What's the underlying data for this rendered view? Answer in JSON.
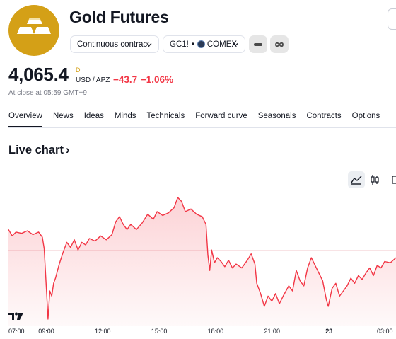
{
  "header": {
    "title": "Gold Futures",
    "contract_label": "Continuous contract",
    "symbol": "GC1!",
    "separator": "•",
    "exchange": "COMEX"
  },
  "quote": {
    "price": "4,065.4",
    "price_sup": "D",
    "currency": "USD / APZ",
    "change": "−43.7 −1.06%",
    "close_time": "At close at 05:59 GMT+9"
  },
  "tabs": [
    "Overview",
    "News",
    "Ideas",
    "Minds",
    "Technicals",
    "Forward curve",
    "Seasonals",
    "Contracts",
    "Options"
  ],
  "live_chart": {
    "label": "Live chart",
    "arrow": "›"
  },
  "icons": {
    "logo": "gold-bars-icon",
    "contract_chevron": "chevron-down-icon",
    "exchange_chevron": "chevron-down-icon",
    "compare": "minus-icon",
    "link": "infinity-link-icon",
    "area_chart": "area-chart-icon",
    "candles": "candlestick-icon",
    "brand": "tradingview-logo-icon"
  },
  "colors": {
    "accent_gold": "#d4a017",
    "negative": "#f23645",
    "line": "#f23645",
    "text": "#131722",
    "muted": "#787b86"
  },
  "chart_data": {
    "type": "area",
    "xlabels": [
      "07:00",
      "09:00",
      "12:00",
      "15:00",
      "18:00",
      "21:00",
      "23",
      "03:00"
    ],
    "x_positions_hours": [
      0,
      2,
      5,
      8,
      11,
      14,
      17,
      20
    ],
    "x_range_hours": [
      0,
      20.6
    ],
    "y_range": [
      4035,
      4140
    ],
    "grid": false,
    "points": [
      [
        0.0,
        4110
      ],
      [
        0.2,
        4105
      ],
      [
        0.4,
        4108
      ],
      [
        0.7,
        4107
      ],
      [
        1.0,
        4109
      ],
      [
        1.3,
        4106
      ],
      [
        1.6,
        4108
      ],
      [
        1.8,
        4104
      ],
      [
        1.9,
        4095
      ],
      [
        2.05,
        4055
      ],
      [
        2.1,
        4040
      ],
      [
        2.2,
        4062
      ],
      [
        2.3,
        4058
      ],
      [
        2.4,
        4068
      ],
      [
        2.5,
        4072
      ],
      [
        2.7,
        4083
      ],
      [
        2.9,
        4092
      ],
      [
        3.1,
        4100
      ],
      [
        3.3,
        4096
      ],
      [
        3.5,
        4102
      ],
      [
        3.7,
        4094
      ],
      [
        3.9,
        4100
      ],
      [
        4.1,
        4098
      ],
      [
        4.3,
        4103
      ],
      [
        4.6,
        4101
      ],
      [
        4.9,
        4105
      ],
      [
        5.2,
        4102
      ],
      [
        5.5,
        4106
      ],
      [
        5.7,
        4116
      ],
      [
        5.9,
        4120
      ],
      [
        6.1,
        4114
      ],
      [
        6.3,
        4110
      ],
      [
        6.5,
        4114
      ],
      [
        6.8,
        4110
      ],
      [
        7.1,
        4115
      ],
      [
        7.4,
        4122
      ],
      [
        7.7,
        4118
      ],
      [
        7.9,
        4124
      ],
      [
        8.2,
        4121
      ],
      [
        8.5,
        4123
      ],
      [
        8.8,
        4127
      ],
      [
        9.0,
        4135
      ],
      [
        9.2,
        4132
      ],
      [
        9.4,
        4124
      ],
      [
        9.7,
        4126
      ],
      [
        10.0,
        4122
      ],
      [
        10.3,
        4120
      ],
      [
        10.5,
        4114
      ],
      [
        10.6,
        4090
      ],
      [
        10.7,
        4078
      ],
      [
        10.8,
        4094
      ],
      [
        10.95,
        4084
      ],
      [
        11.1,
        4088
      ],
      [
        11.3,
        4085
      ],
      [
        11.5,
        4081
      ],
      [
        11.7,
        4086
      ],
      [
        11.9,
        4080
      ],
      [
        12.1,
        4083
      ],
      [
        12.4,
        4080
      ],
      [
        12.7,
        4086
      ],
      [
        12.9,
        4091
      ],
      [
        13.1,
        4083
      ],
      [
        13.2,
        4068
      ],
      [
        13.4,
        4060
      ],
      [
        13.6,
        4050
      ],
      [
        13.8,
        4058
      ],
      [
        14.0,
        4054
      ],
      [
        14.2,
        4060
      ],
      [
        14.4,
        4052
      ],
      [
        14.6,
        4058
      ],
      [
        14.9,
        4066
      ],
      [
        15.1,
        4062
      ],
      [
        15.3,
        4078
      ],
      [
        15.5,
        4070
      ],
      [
        15.7,
        4066
      ],
      [
        15.9,
        4080
      ],
      [
        16.1,
        4088
      ],
      [
        16.3,
        4082
      ],
      [
        16.5,
        4076
      ],
      [
        16.7,
        4070
      ],
      [
        16.9,
        4055
      ],
      [
        17.0,
        4050
      ],
      [
        17.2,
        4064
      ],
      [
        17.4,
        4068
      ],
      [
        17.6,
        4058
      ],
      [
        17.8,
        4062
      ],
      [
        18.0,
        4066
      ],
      [
        18.2,
        4072
      ],
      [
        18.4,
        4068
      ],
      [
        18.6,
        4074
      ],
      [
        18.8,
        4071
      ],
      [
        19.0,
        4076
      ],
      [
        19.2,
        4080
      ],
      [
        19.4,
        4074
      ],
      [
        19.6,
        4082
      ],
      [
        19.8,
        4080
      ],
      [
        20.0,
        4085
      ],
      [
        20.3,
        4084
      ],
      [
        20.6,
        4088
      ]
    ]
  }
}
